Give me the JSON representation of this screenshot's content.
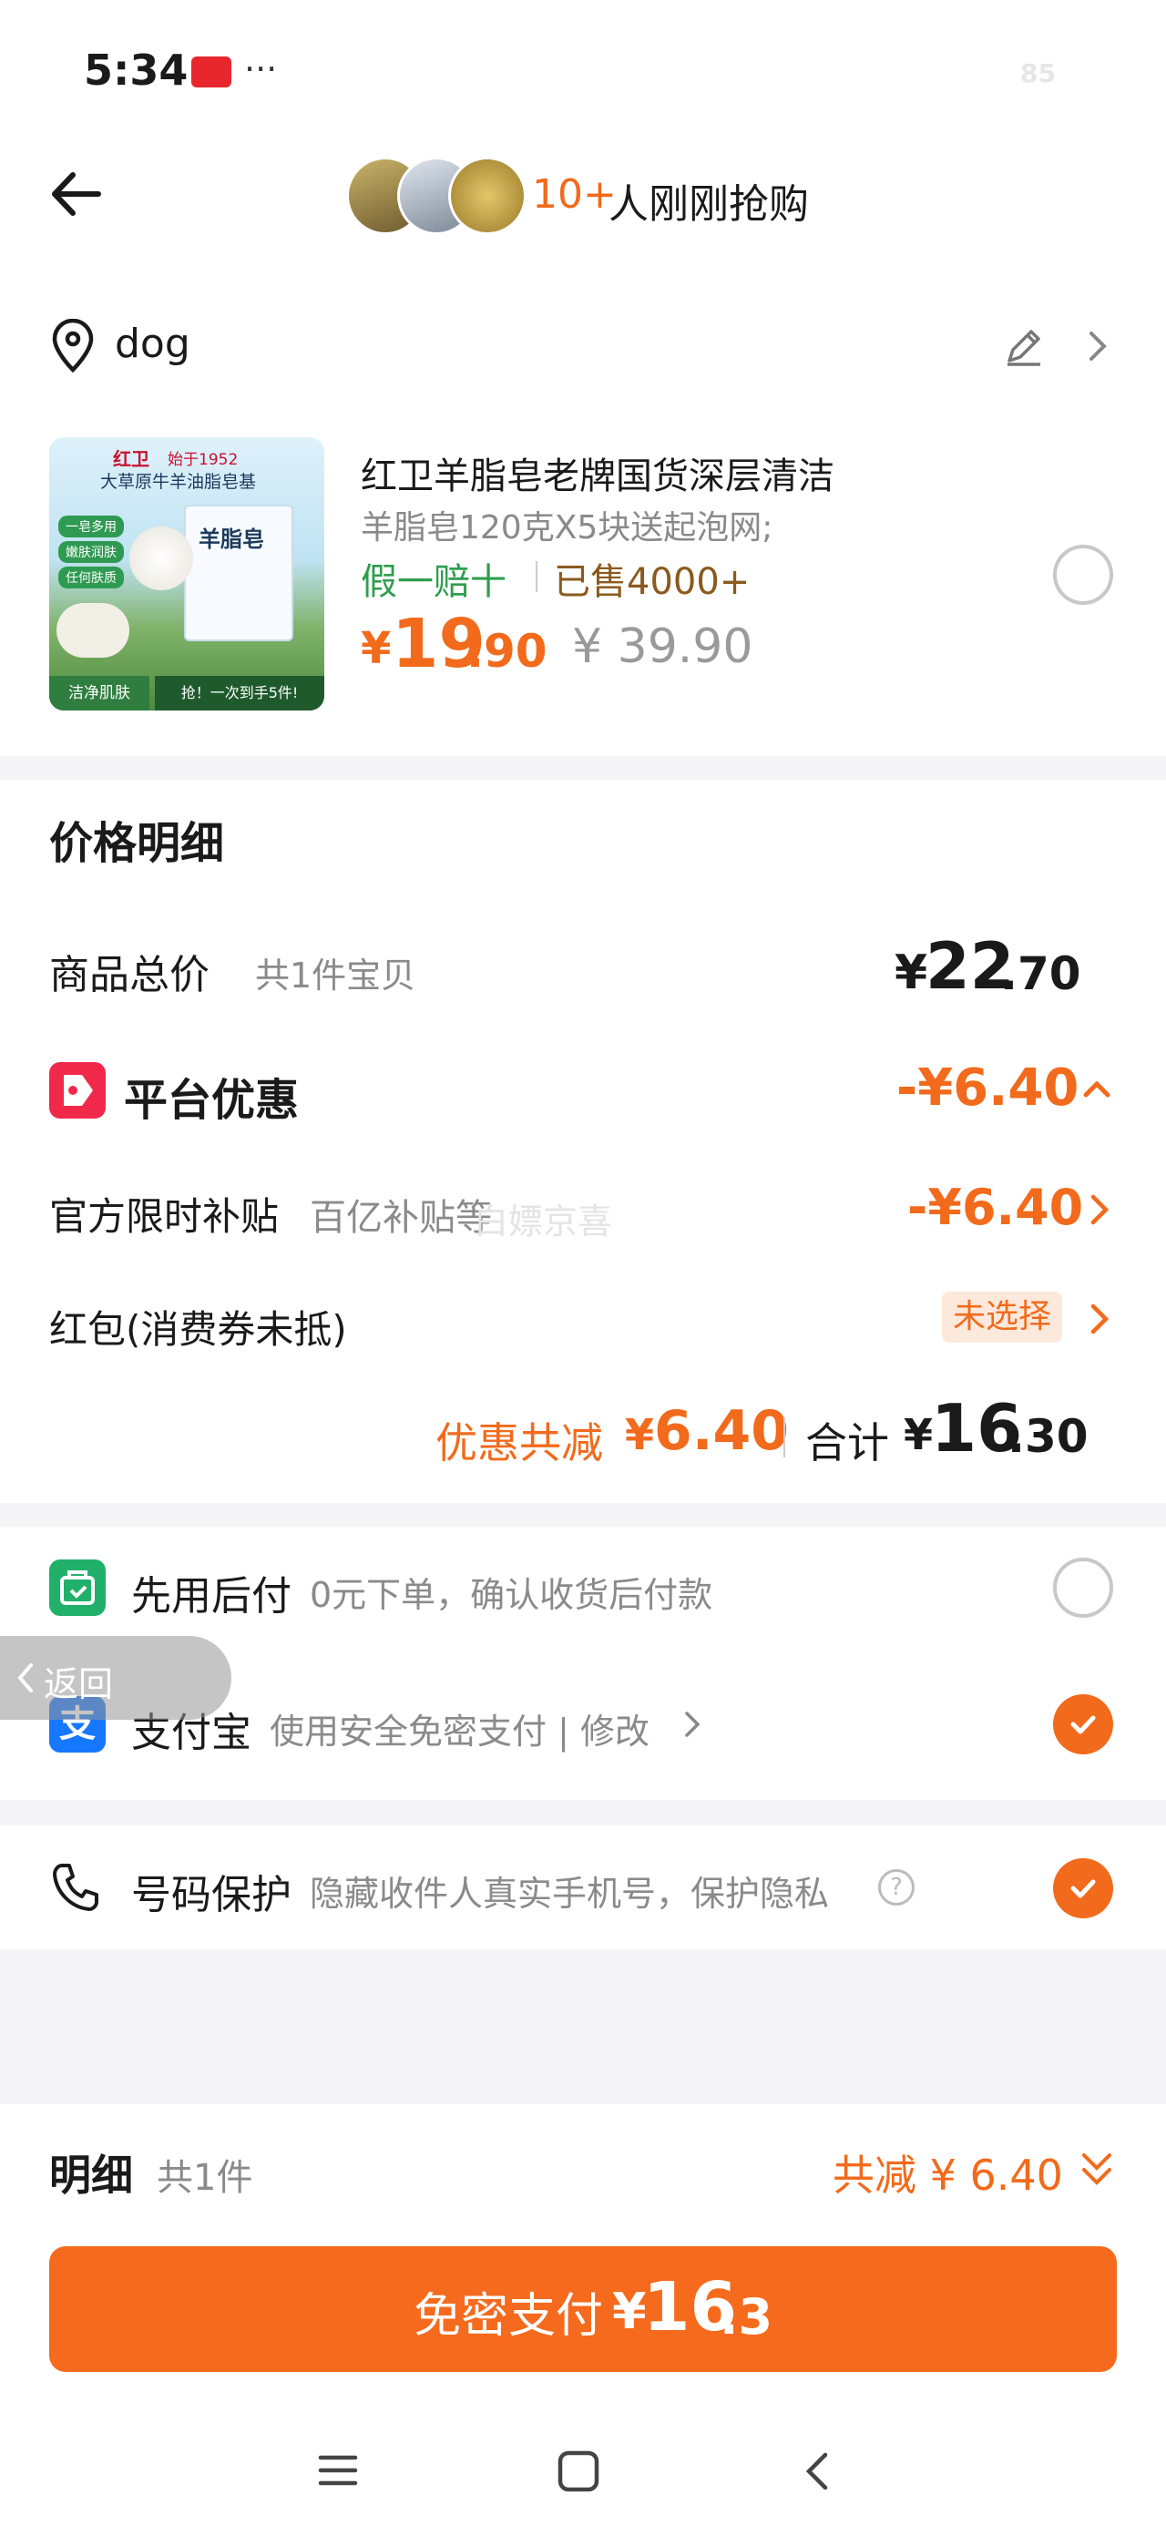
{
  "status_bar": {
    "time": "5:34",
    "dots": "···",
    "battery": "85"
  },
  "header": {
    "count_text": "10+",
    "label": "人刚刚抢购"
  },
  "address": {
    "name": "dog"
  },
  "product": {
    "title": "红卫羊脂皂老牌国货深层清洁",
    "spec": "羊脂皂120克X5块送起泡网;",
    "guarantee": "假一赔十",
    "sold": "已售4000+",
    "price_symbol": "¥",
    "price_int": "19",
    "price_dec": ".90",
    "original_price": "¥ 39.90",
    "image_texts": {
      "brand": "红卫",
      "since": "始于1952",
      "headline": "大草原牛羊油脂皂基",
      "tag1": "一皂多用",
      "tag2": "嫩肤润肤",
      "tag3": "任何肤质",
      "box_label": "羊脂皂",
      "bottom_left": "洁净肌肤",
      "bottom_right": "抢！一次到手5件!"
    }
  },
  "price_detail": {
    "title": "价格明细",
    "total_label": "商品总价",
    "total_count": "共1件宝贝",
    "total_symbol": "¥",
    "total_int": "22",
    "total_dec": ".70",
    "platform_label": "平台优惠",
    "platform_value": "-¥6.40",
    "subsidy_label": "官方限时补贴",
    "subsidy_sub": "百亿补贴等",
    "subsidy_value": "-¥6.40",
    "redpacket_label": "红包(消费券未抵)",
    "redpacket_value": "未选择",
    "discount_label": "优惠共减",
    "discount_symbol": "¥",
    "discount_value": "6.40",
    "sum_label": "合计",
    "sum_symbol": "¥",
    "sum_int": "16",
    "sum_dec": ".30",
    "watermark": "白嫖京喜"
  },
  "payment": {
    "later_label": "先用后付",
    "later_desc": "0元下单，确认收货后付款",
    "alipay_label": "支付宝",
    "alipay_desc": "使用安全免密支付 | 修改",
    "alipay_icon_char": "支"
  },
  "back_float": {
    "label": "返回"
  },
  "privacy": {
    "label": "号码保护",
    "desc": "隐藏收件人真实手机号，保护隐私"
  },
  "bottom": {
    "detail_label": "明细",
    "detail_count": "共1件",
    "detail_discount": "共减 ¥ 6.40",
    "pay_label": "免密支付",
    "pay_symbol": "¥",
    "pay_int": "16",
    "pay_dec": ".3"
  },
  "colors": {
    "accent": "#f26a1b",
    "green": "#2e9e4f",
    "brown": "#8a5a1c",
    "alipay": "#1677ff",
    "red_tag": "#f0294a"
  }
}
